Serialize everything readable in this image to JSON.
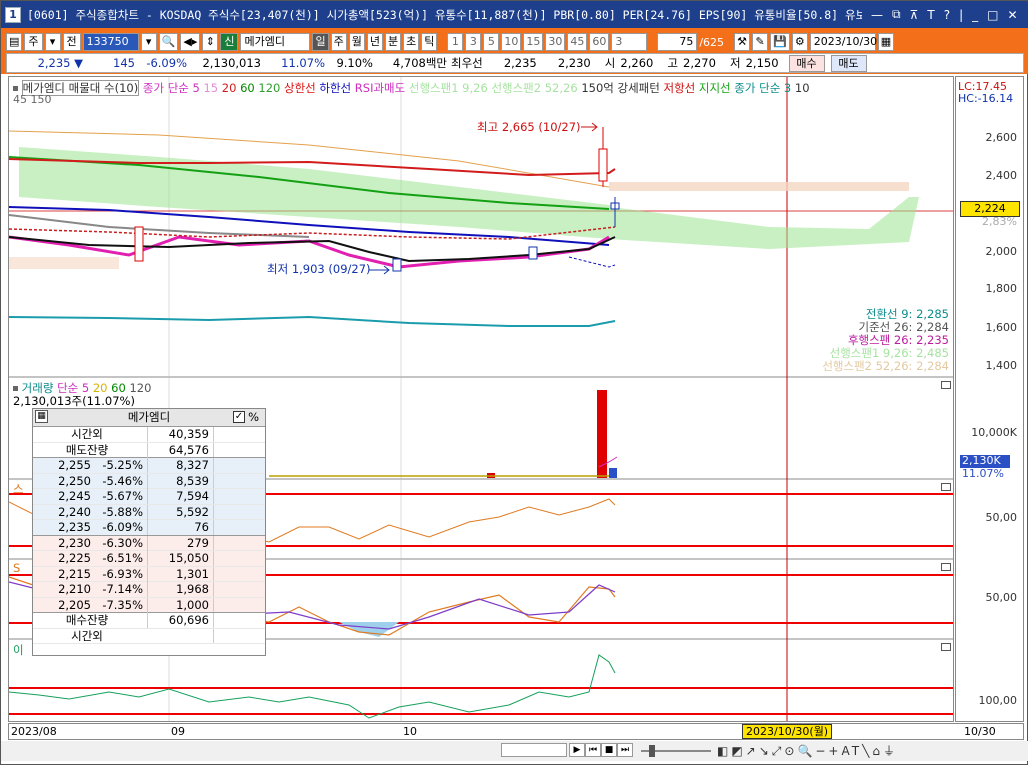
{
  "window": {
    "num": "1",
    "title": "[0601] 주식종합차트 - KOSDAQ 주식수[23,407(천)] 시가총액[523(억)] 유통수[11,887(천)] PBR[0.80] PER[24.76] EPS[90] 유통비율[50.8] 유보율[4€"
  },
  "toolbar": {
    "period_btn": "주",
    "code_btn": "전",
    "code": "133750",
    "name": "메가엠디",
    "tag": "신",
    "periods": [
      "일",
      "주",
      "월",
      "년",
      "분",
      "초",
      "틱"
    ],
    "minutes": [
      "1",
      "3",
      "5",
      "10",
      "15",
      "30",
      "45",
      "60"
    ],
    "count_select": "3",
    "count": "75",
    "total": "/625",
    "date": "2023/10/30"
  },
  "quote": {
    "price": "2,235 ▼",
    "change": "145",
    "change_pct": "-6.09%",
    "volume": "2,130,013",
    "vol_pct": "11.07%",
    "turnover": "9.10%",
    "amount": "4,708백만",
    "best_label": "최우선",
    "best_ask": "2,235",
    "best_bid": "2,230",
    "open_label": "시",
    "open": "2,260",
    "high_label": "고",
    "high": "2,270",
    "low_label": "저",
    "low": "2,150",
    "buy_btn": "매수",
    "sell_btn": "매도"
  },
  "price_panel": {
    "legend": [
      {
        "text": "메가엠디 매물대 수(10)",
        "color": "#333333"
      },
      {
        "text": "종가 단순 5",
        "color": "#cc2fbf"
      },
      {
        "text": "15",
        "color": "#e38ed6"
      },
      {
        "text": "20",
        "color": "#d21c1c"
      },
      {
        "text": "60",
        "color": "#008800"
      },
      {
        "text": "120",
        "color": "#2e9f2e"
      },
      {
        "text": "상한선",
        "color": "#dd1010"
      },
      {
        "text": "하한선",
        "color": "#1010bb"
      },
      {
        "text": "RSI과매도",
        "color": "#cc2fbf"
      },
      {
        "text": "선행스팬1 9,26",
        "color": "#a6e3a0"
      },
      {
        "text": "선행스팬2 52,26",
        "color": "#a6e3a0"
      },
      {
        "text": "150억 강세패턴",
        "color": "#333333"
      },
      {
        "text": "저항선",
        "color": "#cc1010"
      },
      {
        "text": "지지선",
        "color": "#1aa31a"
      },
      {
        "text": "종가 단순 3",
        "color": "#0c8c8c"
      },
      {
        "text": "10",
        "color": "#333333"
      }
    ],
    "legend2": "45 150",
    "lc": "LC:17.45",
    "hc": "HC:-16.14",
    "high_annot": "최고 2,665 (10/27)",
    "low_annot": "최저 1,903 (09/27)",
    "y_ticks": [
      "2,600",
      "2,400",
      "2,200",
      "2,000",
      "1,800",
      "1,600",
      "1,400"
    ],
    "current_price_box": "2,224",
    "behind_tick": "2,83%",
    "ichimoku": [
      {
        "text": "전환선 9: 2,285",
        "color": "#0c8c8c"
      },
      {
        "text": "기준선 26: 2,284",
        "color": "#555555"
      },
      {
        "text": "후행스팬 26: 2,235",
        "color": "#bb1a9e"
      },
      {
        "text": "선행스팬1 9,26: 2,485",
        "color": "#a6e3a0"
      },
      {
        "text": "선행스팬2 52,26: 2,284",
        "color": "#e2c9a0"
      }
    ]
  },
  "volume_panel": {
    "legend": [
      {
        "text": "거래량",
        "color": "#0c8c8c"
      },
      {
        "text": "단순 5",
        "color": "#cc2fbf"
      },
      {
        "text": "20",
        "color": "#d6b400"
      },
      {
        "text": "60",
        "color": "#008800"
      },
      {
        "text": "120",
        "color": "#555555"
      }
    ],
    "info": "2,130,013주(11.07%)",
    "y_tick": "10,000K",
    "cur_box": "2,130K",
    "cur_pct": "11.07%"
  },
  "panels": {
    "p3_label": "스",
    "p3_tick": "50,00",
    "p4_label": "S",
    "p4_tick": "50,00",
    "p5_label": "이",
    "p5_tick": "100,00"
  },
  "orderbook": {
    "title": "메가엠디",
    "pct_label": "%",
    "top": [
      {
        "label": "시간외",
        "value": "40,359"
      },
      {
        "label": "매도잔량",
        "value": "64,576"
      }
    ],
    "asks": [
      {
        "price": "2,255",
        "pct": "-5.25%",
        "qty": "8,327"
      },
      {
        "price": "2,250",
        "pct": "-5.46%",
        "qty": "8,539"
      },
      {
        "price": "2,245",
        "pct": "-5.67%",
        "qty": "7,594"
      },
      {
        "price": "2,240",
        "pct": "-5.88%",
        "qty": "5,592"
      },
      {
        "price": "2,235",
        "pct": "-6.09%",
        "qty": "76"
      }
    ],
    "bids": [
      {
        "price": "2,230",
        "pct": "-6.30%",
        "qty": "279"
      },
      {
        "price": "2,225",
        "pct": "-6.51%",
        "qty": "15,050"
      },
      {
        "price": "2,215",
        "pct": "-6.93%",
        "qty": "1,301"
      },
      {
        "price": "2,210",
        "pct": "-7.14%",
        "qty": "1,968"
      },
      {
        "price": "2,205",
        "pct": "-7.35%",
        "qty": "1,000"
      }
    ],
    "bottom": [
      {
        "label": "매수잔량",
        "value": "60,696"
      },
      {
        "label": "시간외",
        "value": ""
      }
    ]
  },
  "xaxis": {
    "labels": [
      "2023/08",
      "09",
      "10"
    ],
    "cursor_date": "2023/10/30(월)",
    "right_label": "10/30"
  },
  "colors": {
    "toolbar": "#f36f1a",
    "titlebar": "#1d3f8c",
    "up": "#dd1111",
    "down": "#1133aa"
  }
}
